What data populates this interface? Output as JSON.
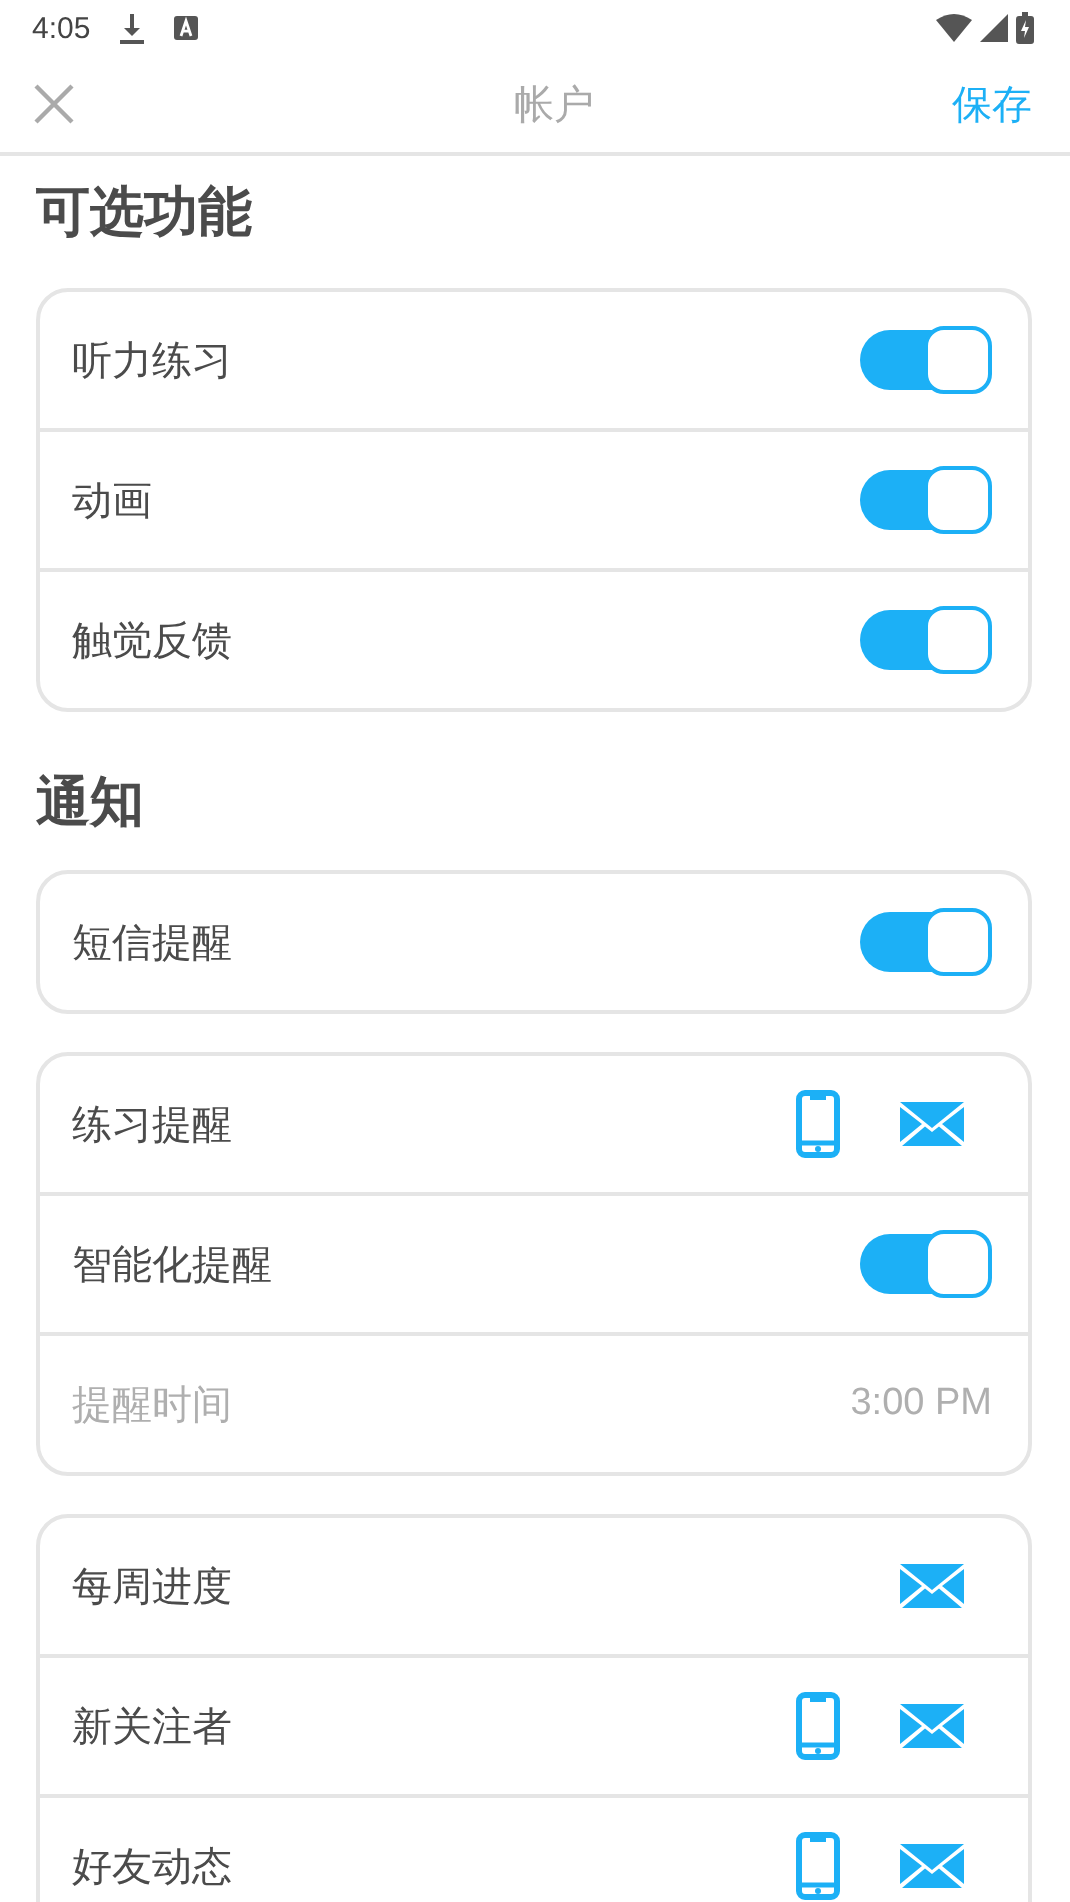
{
  "status_bar": {
    "time": "4:05"
  },
  "header": {
    "title": "帐户",
    "action": "保存"
  },
  "sections": [
    {
      "title": "可选功能",
      "cards": [
        {
          "rows": [
            {
              "kind": "toggle",
              "label": "听力练习",
              "on": true
            },
            {
              "kind": "toggle",
              "label": "动画",
              "on": true
            },
            {
              "kind": "toggle",
              "label": "触觉反馈",
              "on": true
            }
          ]
        }
      ]
    },
    {
      "title": "通知",
      "cards": [
        {
          "rows": [
            {
              "kind": "toggle",
              "label": "短信提醒",
              "on": true
            }
          ]
        },
        {
          "rows": [
            {
              "kind": "channels",
              "label": "练习提醒",
              "phone": true,
              "email": true
            },
            {
              "kind": "toggle",
              "label": "智能化提醒",
              "on": true
            },
            {
              "kind": "time",
              "label": "提醒时间",
              "value": "3:00 PM",
              "disabled": true
            }
          ]
        },
        {
          "rows": [
            {
              "kind": "channels",
              "label": "每周进度",
              "phone": false,
              "email": true
            },
            {
              "kind": "channels",
              "label": "新关注者",
              "phone": true,
              "email": true
            },
            {
              "kind": "channels",
              "label": "好友动态",
              "phone": true,
              "email": true
            }
          ]
        }
      ]
    }
  ]
}
